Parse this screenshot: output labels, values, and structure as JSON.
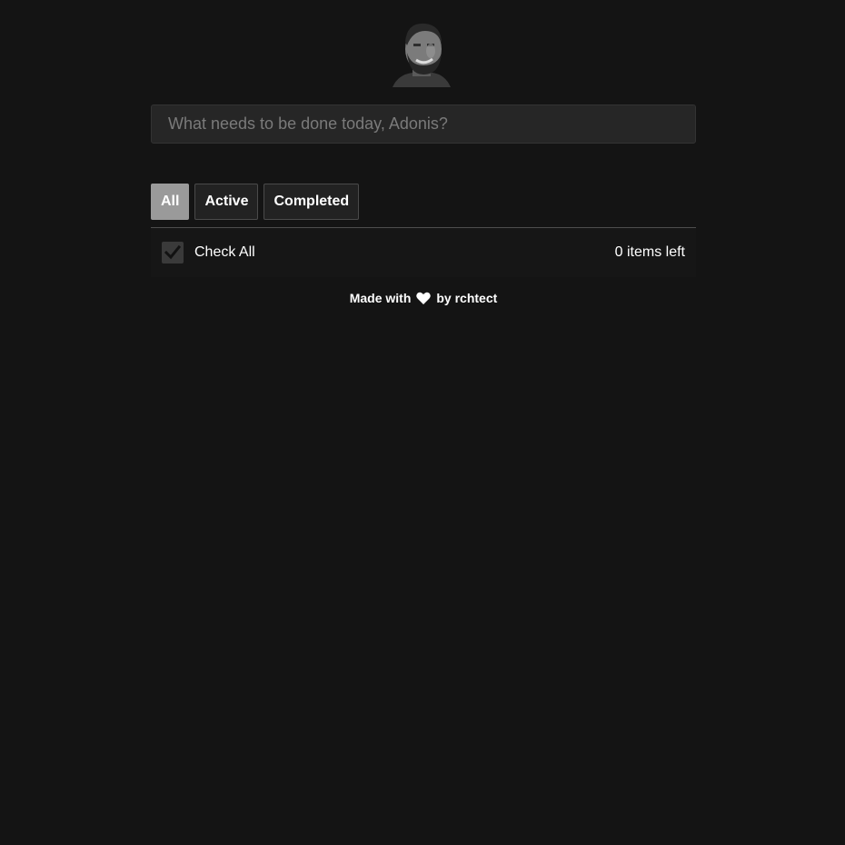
{
  "input": {
    "placeholder": "What needs to be done today, Adonis?",
    "value": ""
  },
  "filters": [
    {
      "label": "All",
      "selected": true
    },
    {
      "label": "Active",
      "selected": false
    },
    {
      "label": "Completed",
      "selected": false
    }
  ],
  "toolbar": {
    "check_all_label": "Check All",
    "check_all_checked": true,
    "items_left": "0 items left"
  },
  "footer": {
    "made_with": "Made with",
    "by": "by rchtect",
    "icon": "heart-icon"
  },
  "colors": {
    "background": "#141414",
    "input_bg": "#262626",
    "active_filter": "#9a9a9a"
  }
}
